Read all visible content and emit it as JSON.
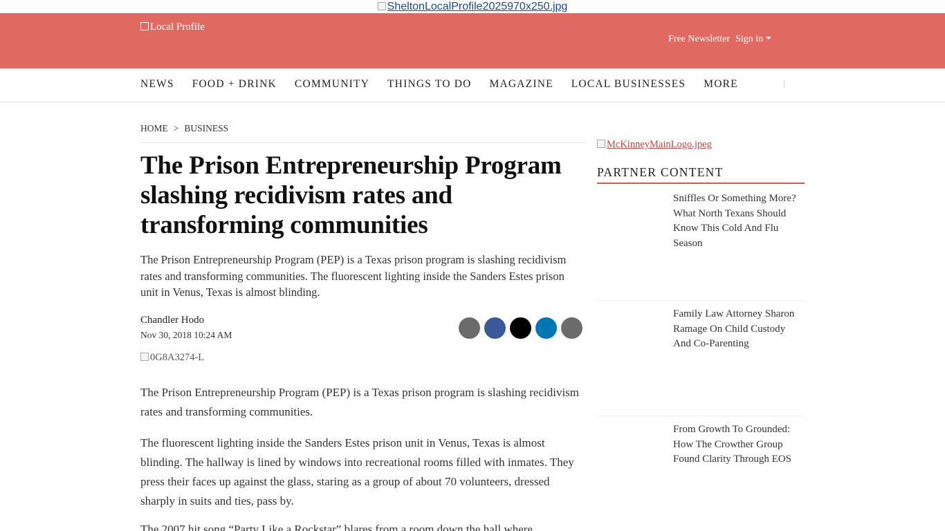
{
  "top_ad": {
    "alt": "SheltonLocalProfile2025970x250.jpg"
  },
  "masthead": {
    "logo_alt": "Local Profile",
    "newsletter": "Free Newsletter",
    "signin": "Sign in",
    "background": "#e06a62"
  },
  "nav": {
    "items": [
      "NEWS",
      "FOOD + DRINK",
      "COMMUNITY",
      "THINGS TO DO",
      "MAGAZINE",
      "LOCAL BUSINESSES",
      "MORE"
    ]
  },
  "breadcrumb": {
    "home": "HOME",
    "separator": ">",
    "section": "BUSINESS"
  },
  "article": {
    "headline": "The Prison Entrepreneurship Program slashing recidivism rates and transforming communities",
    "dek": "The Prison Entrepreneurship Program (PEP) is a Texas prison program is slashing recidivism rates and transforming communities. The fluorescent lighting inside the Sanders Estes prison unit in Venus, Texas is almost blinding.",
    "author": "Chandler Hodo",
    "date": "Nov 30, 2018 10:24 AM",
    "photo_alt": "0G8A3274-L",
    "paragraphs": [
      "The Prison Entrepreneurship Program (PEP) is a Texas prison program is slashing recidivism rates and transforming communities.",
      "The fluorescent lighting inside the Sanders Estes prison unit in Venus, Texas is almost blinding. The hallway is lined by windows into recreational rooms filled with inmates. They press their faces up against the glass, staring as a group of about 70 volunteers, dressed sharply in suits and ties, pass by.",
      "The 2007 hit song “Party Like a Rockstar” blares from a room down the hall where"
    ]
  },
  "share": {
    "buttons": [
      {
        "icon": "share-icon",
        "color": "#6b6b6b"
      },
      {
        "icon": "facebook-icon",
        "color": "#3b5998"
      },
      {
        "icon": "x-icon",
        "color": "#000000"
      },
      {
        "icon": "linkedin-icon",
        "color": "#0077b5"
      },
      {
        "icon": "email-icon",
        "color": "#6b6b6b"
      }
    ]
  },
  "sidebar": {
    "logo_alt": "McKinneyMainLogo.jpeg",
    "partner_title": "PARTNER CONTENT",
    "accent": "#d9534f",
    "items": [
      "Sniffles Or Something More? What North Texans Should Know This Cold And Flu Season",
      "Family Law Attorney Sharon Ramage On Child Custody And Co-Parenting",
      "From Growth To Grounded: How The Crowther Group Found Clarity Through EOS"
    ]
  }
}
